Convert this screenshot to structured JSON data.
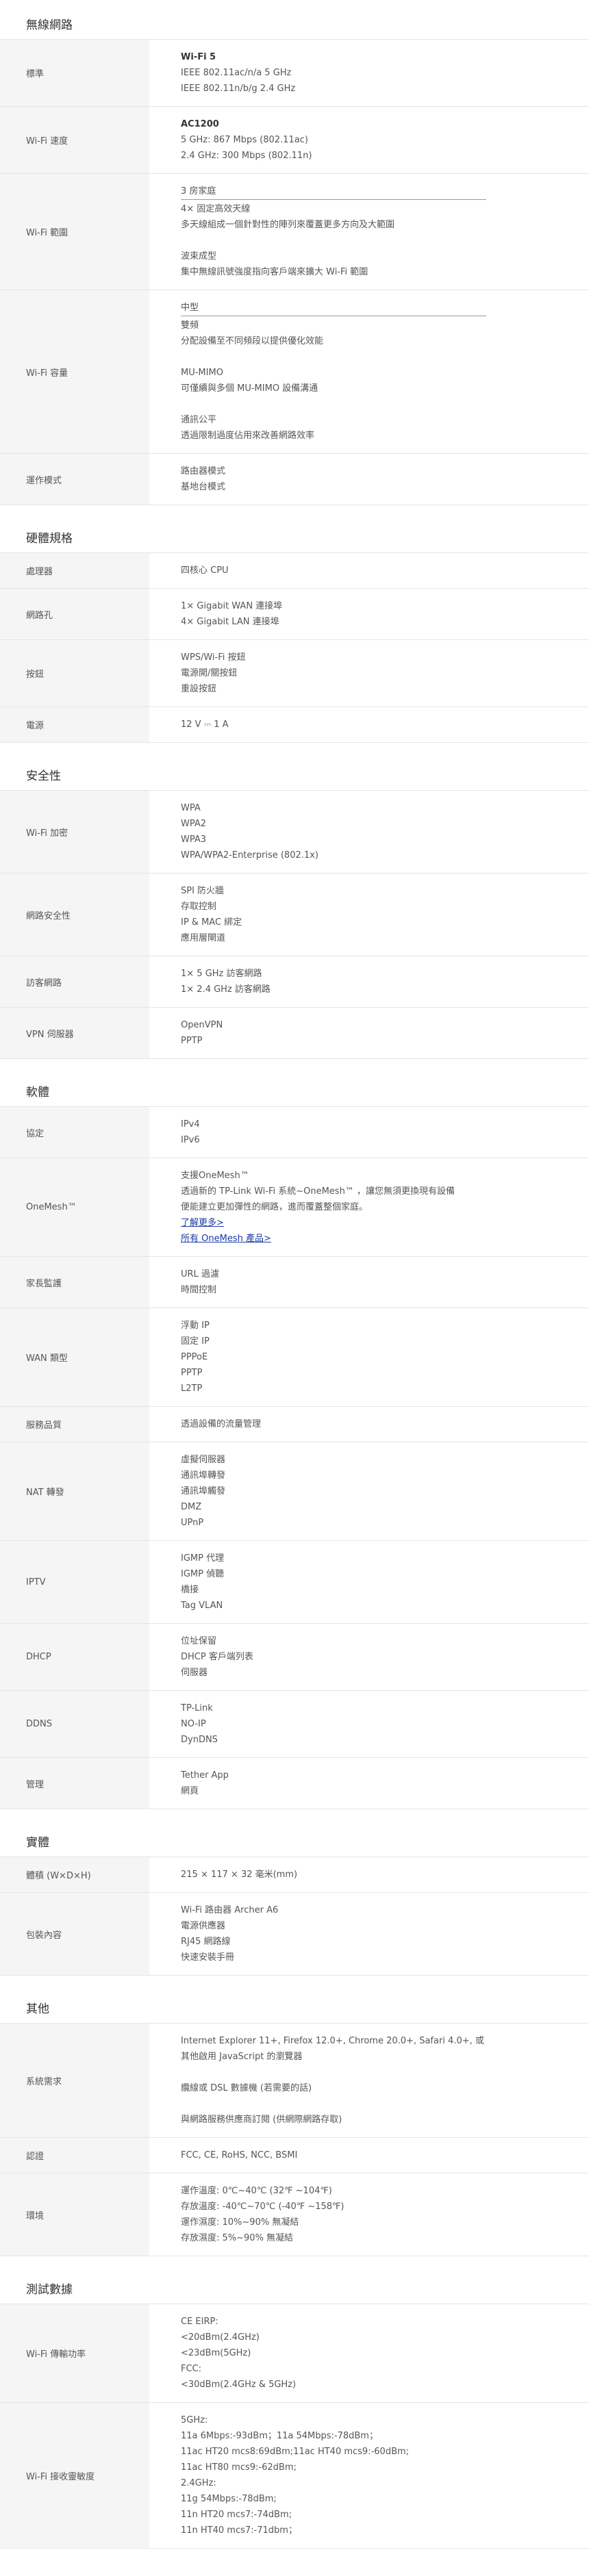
{
  "sections": [
    {
      "title": "無線網路",
      "rows": [
        {
          "label": "標準",
          "lines": [
            {
              "text": "Wi-Fi 5",
              "style": "bold"
            },
            {
              "text": "IEEE 802.11ac/n/a 5 GHz"
            },
            {
              "text": "IEEE 802.11n/b/g 2.4 GHz"
            }
          ]
        },
        {
          "label": "Wi-Fi 速度",
          "lines": [
            {
              "text": "AC1200",
              "style": "bold"
            },
            {
              "text": "5 GHz: 867 Mbps (802.11ac)"
            },
            {
              "text": "2.4 GHz: 300 Mbps (802.11n)"
            }
          ]
        },
        {
          "label": "Wi-Fi 範圍",
          "lines": [
            {
              "text": "3 房家庭",
              "style": "heading"
            },
            {
              "text": "4× 固定高效天線"
            },
            {
              "text": "多天線組成一個針對性的陣列來覆蓋更多方向及大範圍"
            },
            {
              "text": "",
              "style": "gap"
            },
            {
              "text": "波束成型"
            },
            {
              "text": "集中無線訊號強度指向客戶端來擴大 Wi-Fi 範圍"
            }
          ]
        },
        {
          "label": "Wi-Fi 容量",
          "lines": [
            {
              "text": "中型",
              "style": "heading"
            },
            {
              "text": "雙頻"
            },
            {
              "text": "分配設備至不同頻段以提供優化效能"
            },
            {
              "text": "",
              "style": "gap"
            },
            {
              "text": "MU-MIMO"
            },
            {
              "text": "可僅續與多個 MU-MIMO 設備溝通"
            },
            {
              "text": "",
              "style": "gap"
            },
            {
              "text": "通訊公平"
            },
            {
              "text": "透過限制過度佔用來改善網路效率"
            }
          ]
        },
        {
          "label": "運作模式",
          "lines": [
            {
              "text": "路由器模式"
            },
            {
              "text": "基地台模式"
            }
          ]
        }
      ]
    },
    {
      "title": "硬體規格",
      "rows": [
        {
          "label": "處理器",
          "lines": [
            {
              "text": "四核心 CPU"
            }
          ]
        },
        {
          "label": "網路孔",
          "lines": [
            {
              "text": "1× Gigabit WAN 連接埠"
            },
            {
              "text": "4× Gigabit LAN 連接埠"
            }
          ]
        },
        {
          "label": "按鈕",
          "lines": [
            {
              "text": "WPS/Wi-Fi 按鈕"
            },
            {
              "text": "電源開/關按鈕"
            },
            {
              "text": "重設按鈕"
            }
          ]
        },
        {
          "label": "電源",
          "lines": [
            {
              "text": "12 V ⎓ 1 A"
            }
          ]
        }
      ]
    },
    {
      "title": "安全性",
      "rows": [
        {
          "label": "Wi-Fi 加密",
          "lines": [
            {
              "text": "WPA"
            },
            {
              "text": "WPA2"
            },
            {
              "text": "WPA3"
            },
            {
              "text": "WPA/WPA2-Enterprise (802.1x)"
            }
          ]
        },
        {
          "label": "網路安全性",
          "lines": [
            {
              "text": "SPI 防火牆"
            },
            {
              "text": "存取控制"
            },
            {
              "text": "IP & MAC 綁定"
            },
            {
              "text": "應用層閘道"
            }
          ]
        },
        {
          "label": "訪客網路",
          "lines": [
            {
              "text": "1× 5 GHz 訪客網路"
            },
            {
              "text": "1× 2.4 GHz 訪客網路"
            }
          ]
        },
        {
          "label": "VPN 伺服器",
          "lines": [
            {
              "text": "OpenVPN"
            },
            {
              "text": "PPTP"
            }
          ]
        }
      ]
    },
    {
      "title": "軟體",
      "rows": [
        {
          "label": "協定",
          "lines": [
            {
              "text": "IPv4"
            },
            {
              "text": "IPv6"
            }
          ]
        },
        {
          "label": "OneMesh™",
          "lines": [
            {
              "text": "支援OneMesh™"
            },
            {
              "text": "透過新的 TP-Link Wi-Fi 系統~OneMesh™ ，讓您無須更換現有設備"
            },
            {
              "text": "便能建立更加彈性的網路，進而覆蓋整個家庭。"
            },
            {
              "text": "了解更多>",
              "style": "link"
            },
            {
              "text": "所有 OneMesh 產品>",
              "style": "link"
            }
          ]
        },
        {
          "label": "家長監護",
          "lines": [
            {
              "text": "URL 過濾"
            },
            {
              "text": "時間控制"
            }
          ]
        },
        {
          "label": "WAN 類型",
          "lines": [
            {
              "text": "浮動 IP"
            },
            {
              "text": "固定 IP"
            },
            {
              "text": "PPPoE"
            },
            {
              "text": "PPTP"
            },
            {
              "text": "L2TP"
            }
          ]
        },
        {
          "label": "服務品質",
          "lines": [
            {
              "text": "透過設備的流量管理"
            }
          ]
        },
        {
          "label": "NAT 轉發",
          "lines": [
            {
              "text": "虛擬伺服器"
            },
            {
              "text": "通訊埠轉發"
            },
            {
              "text": "通訊埠觸發"
            },
            {
              "text": "DMZ"
            },
            {
              "text": "UPnP"
            }
          ]
        },
        {
          "label": "IPTV",
          "lines": [
            {
              "text": "IGMP 代理"
            },
            {
              "text": "IGMP 偵聽"
            },
            {
              "text": "橋接"
            },
            {
              "text": "Tag VLAN"
            }
          ]
        },
        {
          "label": "DHCP",
          "lines": [
            {
              "text": "位址保留"
            },
            {
              "text": "DHCP 客戶端列表"
            },
            {
              "text": "伺服器"
            }
          ]
        },
        {
          "label": "DDNS",
          "lines": [
            {
              "text": "TP-Link"
            },
            {
              "text": "NO-IP"
            },
            {
              "text": "DynDNS"
            }
          ]
        },
        {
          "label": "管理",
          "lines": [
            {
              "text": "Tether App"
            },
            {
              "text": "網頁"
            }
          ]
        }
      ]
    },
    {
      "title": "實體",
      "rows": [
        {
          "label": "體積 (W×D×H)",
          "lines": [
            {
              "text": "215 × 117 × 32 毫米(mm)"
            }
          ]
        },
        {
          "label": "包裝內容",
          "lines": [
            {
              "text": "Wi-Fi 路由器 Archer A6"
            },
            {
              "text": "電源供應器"
            },
            {
              "text": "RJ45 網路線"
            },
            {
              "text": "快速安裝手冊"
            }
          ]
        }
      ]
    },
    {
      "title": "其他",
      "rows": [
        {
          "label": "系統需求",
          "lines": [
            {
              "text": "Internet Explorer 11+, Firefox 12.0+, Chrome 20.0+, Safari 4.0+, 或"
            },
            {
              "text": "其他啟用 JavaScript 的瀏覽器"
            },
            {
              "text": "",
              "style": "gap"
            },
            {
              "text": "纜線或 DSL 數據機 (若需要的話)"
            },
            {
              "text": "",
              "style": "gap"
            },
            {
              "text": "與網路服務供應商訂閱 (供網際網路存取)"
            }
          ]
        },
        {
          "label": "認證",
          "lines": [
            {
              "text": "FCC, CE, RoHS, NCC, BSMI"
            }
          ]
        },
        {
          "label": "環境",
          "lines": [
            {
              "text": "運作溫度: 0℃~40℃ (32℉ ~104℉)"
            },
            {
              "text": "存放溫度: -40℃~70℃ (-40℉ ~158℉)"
            },
            {
              "text": "運作濕度: 10%~90% 無凝結"
            },
            {
              "text": "存放濕度: 5%~90% 無凝結"
            }
          ]
        }
      ]
    },
    {
      "title": "測試數據",
      "rows": [
        {
          "label": "Wi-Fi 傳輸功率",
          "lines": [
            {
              "text": "CE EIRP:"
            },
            {
              "text": "<20dBm(2.4GHz)"
            },
            {
              "text": "<23dBm(5GHz)"
            },
            {
              "text": "FCC:"
            },
            {
              "text": "<30dBm(2.4GHz & 5GHz)"
            }
          ]
        },
        {
          "label": "Wi-Fi 接收靈敏度",
          "lines": [
            {
              "text": "5GHz:"
            },
            {
              "text": "11a 6Mbps:-93dBm；11a 54Mbps:-78dBm；"
            },
            {
              "text": "11ac HT20 mcs8:69dBm;11ac HT40 mcs9:-60dBm;"
            },
            {
              "text": "11ac HT80 mcs9:-62dBm;"
            },
            {
              "text": "2.4GHz:"
            },
            {
              "text": "11g 54Mbps:-78dBm;"
            },
            {
              "text": "11n HT20 mcs7:-74dBm;"
            },
            {
              "text": "11n HT40 mcs7:-71dbm；"
            }
          ]
        }
      ]
    }
  ]
}
